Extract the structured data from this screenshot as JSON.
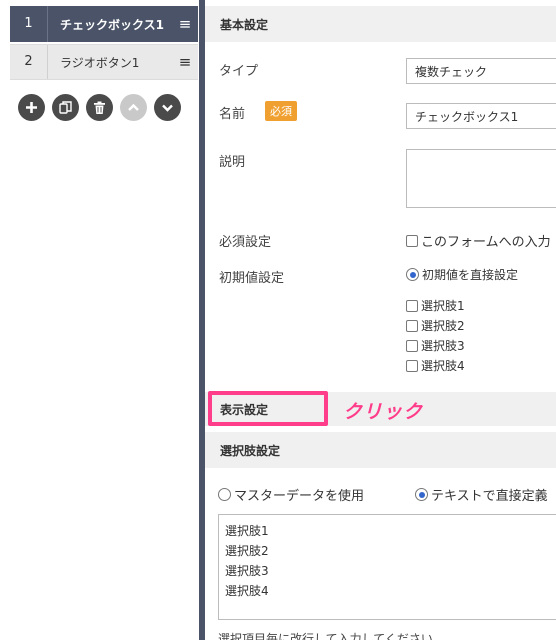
{
  "sidebar": {
    "items": [
      {
        "number": "1",
        "label": "チェックボックス1",
        "menu_icon": "≡"
      },
      {
        "number": "2",
        "label": "ラジオボタン1",
        "menu_icon": "≡"
      }
    ],
    "tools": [
      "add-icon",
      "copy-icon",
      "trash-icon",
      "chevron-up-icon",
      "chevron-down-icon"
    ]
  },
  "basic": {
    "header": "基本設定",
    "type_label": "タイプ",
    "type_value": "複数チェック",
    "name_label": "名前",
    "required_badge": "必須",
    "name_value": "チェックボックス1",
    "desc_label": "説明",
    "required_setting_label": "必須設定",
    "required_option": "このフォームへの入力",
    "initial_label": "初期値設定",
    "initial_radio": "初期値を直接設定",
    "choices": [
      "選択肢1",
      "選択肢2",
      "選択肢3",
      "選択肢4"
    ]
  },
  "display": {
    "header": "表示設定",
    "annotation": "クリック"
  },
  "choice_settings": {
    "header": "選択肢設定",
    "radio_master": "マスターデータを使用",
    "radio_text": "テキストで直接定義",
    "text_lines": [
      "選択肢1",
      "選択肢2",
      "選択肢3",
      "選択肢4"
    ],
    "hint": "選択項目毎に改行して入力してください"
  },
  "colors": {
    "sidebar_active": "#4a5368",
    "badge": "#f0a030",
    "highlight": "#ff3d8b",
    "radio_checked": "#3366cc"
  }
}
